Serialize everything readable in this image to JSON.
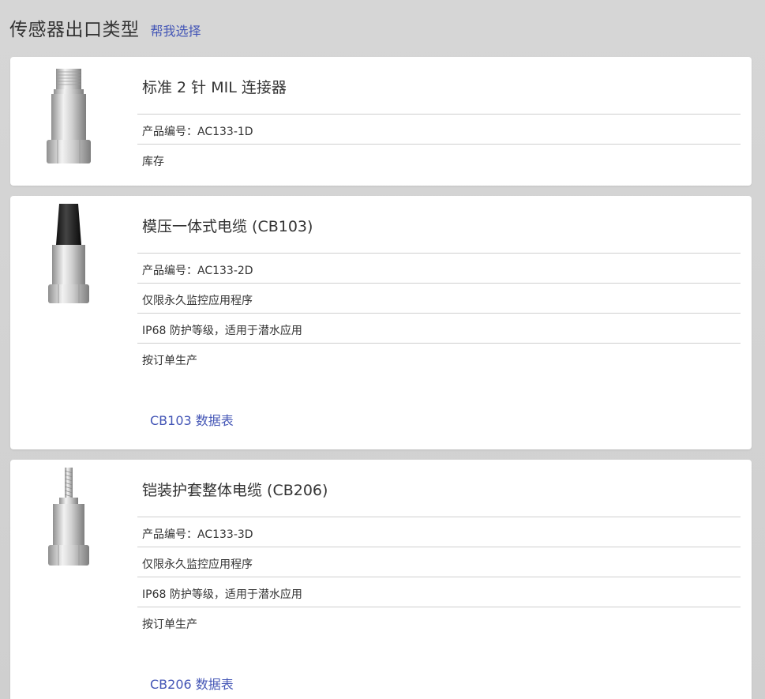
{
  "header": {
    "title": "传感器出口类型",
    "help_link": "帮我选择"
  },
  "products": [
    {
      "name": "标准 2 针 MIL 连接器",
      "image_icon": "sensor-mil-connector-icon",
      "attributes": [
        "产品编号：AC133-1D",
        "库存"
      ]
    },
    {
      "name": "模压一体式电缆 (CB103)",
      "image_icon": "sensor-molded-cable-icon",
      "attributes": [
        "产品编号：AC133-2D",
        "仅限永久监控应用程序",
        "IP68 防护等级，适用于潜水应用",
        "按订单生产"
      ],
      "datasheet_link": "CB103 数据表"
    },
    {
      "name": "铠装护套整体电缆 (CB206)",
      "image_icon": "sensor-armored-cable-icon",
      "attributes": [
        "产品编号：AC133-3D",
        "仅限永久监控应用程序",
        "IP68 防护等级，适用于潜水应用",
        "按订单生产"
      ],
      "datasheet_link": "CB206 数据表"
    }
  ],
  "colors": {
    "link": "#4456b6",
    "text": "#333333",
    "background": "#d3d3d3",
    "card": "#ffffff"
  }
}
